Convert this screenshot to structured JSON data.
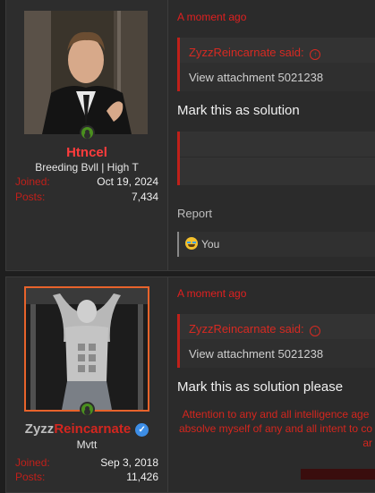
{
  "posts": [
    {
      "user": {
        "name": "Htncel",
        "title": "Breeding Bvll | High T",
        "joined_label": "Joined:",
        "joined": "Oct 19, 2024",
        "posts_label": "Posts:",
        "posts": "7,434",
        "name_color": "#ff3c3c"
      },
      "time": "A moment ago",
      "quote": {
        "author": "ZyzzReincarnate said:",
        "body": "View attachment 5021238"
      },
      "text": "Mark this as solution",
      "report": "Report",
      "reaction": {
        "icon": "crying-laughing-emoji-icon",
        "label": "You"
      }
    },
    {
      "user": {
        "name_part1": "Zyzz",
        "name_part2": "Reincarnate",
        "title": "Mvtt",
        "joined_label": "Joined:",
        "joined": "Sep 3, 2018",
        "posts_label": "Posts:",
        "posts": "11,426",
        "verified_icon": "verified-check-icon"
      },
      "time": "A moment ago",
      "quote": {
        "author": "ZyzzReincarnate said:",
        "body": "View attachment 5021238"
      },
      "text": "Mark this as solution please",
      "signature": {
        "line1": "Attention to any and all intelligence age",
        "line2": "absolve myself of any and all intent to co",
        "line3": "ar"
      }
    }
  ],
  "colors": {
    "accent": "#c0201a",
    "background": "#1e1e1e",
    "panel": "#2b2b2b"
  }
}
